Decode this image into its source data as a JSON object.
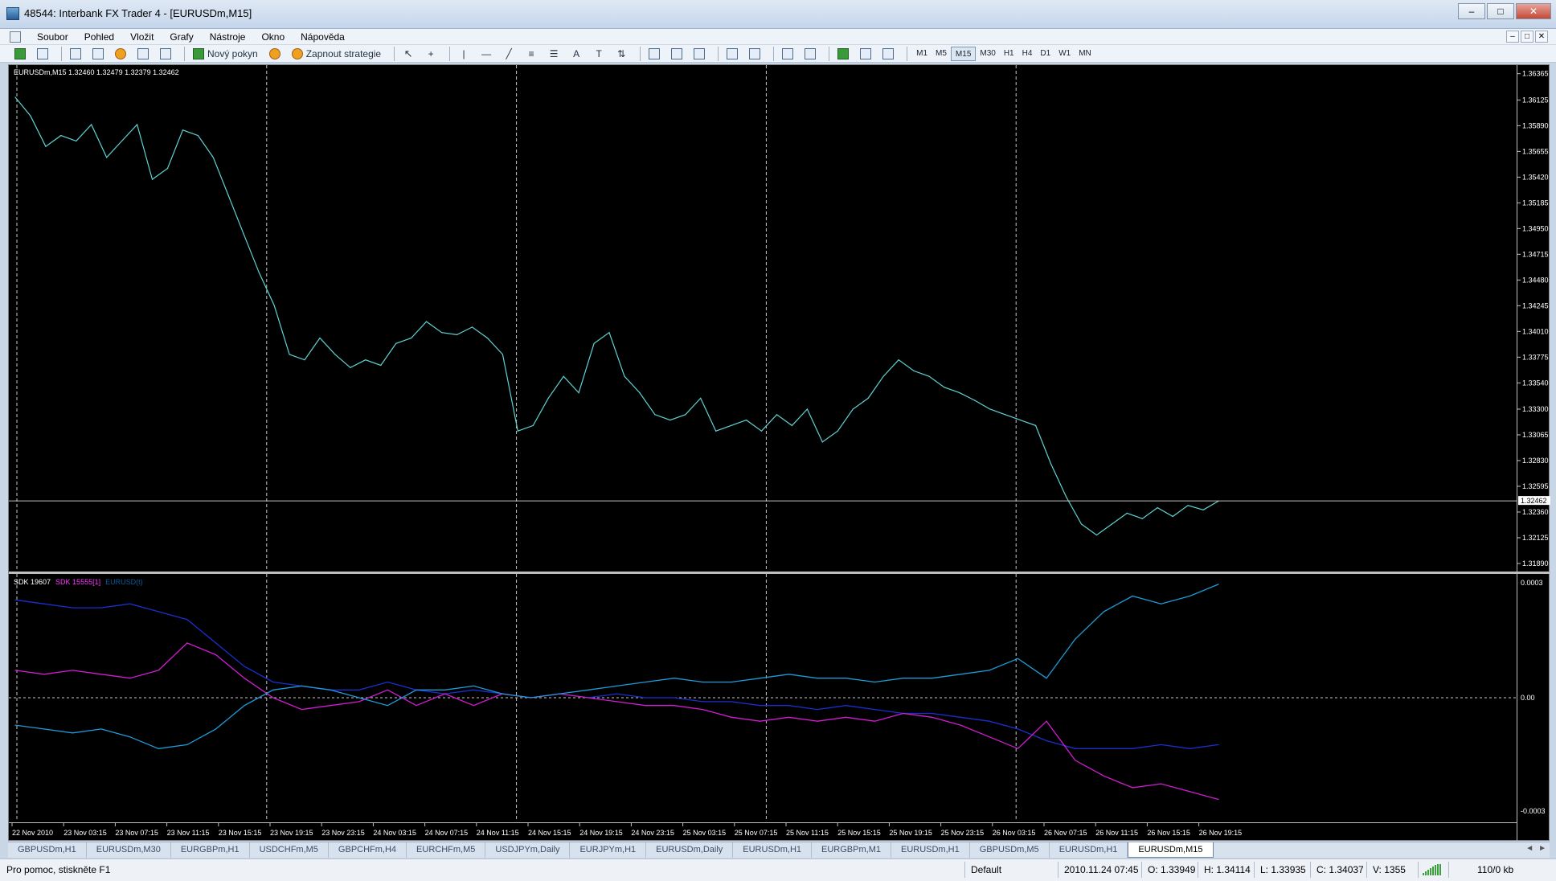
{
  "window": {
    "title": "48544: Interbank FX Trader 4 - [EURUSDm,M15]",
    "buttons": [
      "–",
      "□",
      "✕"
    ]
  },
  "menu": {
    "items": [
      "Soubor",
      "Pohled",
      "Vložit",
      "Grafy",
      "Nástroje",
      "Okno",
      "Nápověda"
    ],
    "mdi_buttons": [
      "–",
      "□",
      "✕"
    ]
  },
  "toolbar": {
    "new_order_label": "Nový pokyn",
    "strategies_label": "Zapnout strategie",
    "periods": [
      "M1",
      "M5",
      "M15",
      "M30",
      "H1",
      "H4",
      "D1",
      "W1",
      "MN"
    ],
    "active_period": "M15"
  },
  "chart": {
    "header": "EURUSDm,M15  1.32460 1.32479 1.32379 1.32462",
    "indicator_labels": [
      "SDK 19607",
      "SDK 15555[1]",
      "EURUSD(t)"
    ],
    "current_price_label": "1.32462",
    "accent_color": "#5fd3d3"
  },
  "chart_data": {
    "type": "line",
    "title": "EURUSDm,M15",
    "main_price": {
      "ylim": [
        1.3189,
        1.3637
      ],
      "yticks": [
        "1.36365",
        "1.36125",
        "1.35890",
        "1.35655",
        "1.35420",
        "1.35185",
        "1.34950",
        "1.34715",
        "1.34480",
        "1.34245",
        "1.34010",
        "1.33775",
        "1.33540",
        "1.33300",
        "1.33065",
        "1.32830",
        "1.32595",
        "1.32360",
        "1.32125",
        "1.31890"
      ],
      "last_price": 1.32462,
      "series": [
        {
          "values": [
            1.3615,
            1.3598,
            1.357,
            1.358,
            1.3575,
            1.359,
            1.356,
            1.3575,
            1.359,
            1.354,
            1.355,
            1.3585,
            1.358,
            1.356,
            1.3525,
            1.349,
            1.3455,
            1.3425,
            1.338,
            1.3375,
            1.3395,
            1.338,
            1.3368,
            1.3375,
            1.337,
            1.339,
            1.3395,
            1.341,
            1.34,
            1.3398,
            1.3405,
            1.3395,
            1.338,
            1.331,
            1.3315,
            1.334,
            1.336,
            1.3345,
            1.339,
            1.34,
            1.336,
            1.3345,
            1.3325,
            1.332,
            1.3325,
            1.334,
            1.331,
            1.3315,
            1.332,
            1.331,
            1.3325,
            1.3315,
            1.333,
            1.33,
            1.331,
            1.333,
            1.334,
            1.336,
            1.3375,
            1.3365,
            1.336,
            1.335,
            1.3345,
            1.3338,
            1.333,
            1.3325,
            1.332,
            1.3315,
            1.328,
            1.325,
            1.3225,
            1.3215,
            1.3225,
            1.3235,
            1.323,
            1.324,
            1.3232,
            1.3242,
            1.3238,
            1.3246
          ]
        }
      ]
    },
    "indicator": {
      "ylim": [
        -0.0003,
        0.0003
      ],
      "yticks": [
        "0.0003",
        "0.00",
        "-0.0003"
      ],
      "series": [
        {
          "values": [
            0.00025,
            0.00024,
            0.00023,
            0.00023,
            0.00024,
            0.00022,
            0.0002,
            0.00014,
            8e-05,
            4e-05,
            3e-05,
            2e-05,
            2e-05,
            4e-05,
            2e-05,
            1e-05,
            2e-05,
            1e-05,
            0.0,
            1e-05,
            0.0,
            1e-05,
            0.0,
            0.0,
            -1e-05,
            -1e-05,
            -2e-05,
            -2e-05,
            -3e-05,
            -2e-05,
            -3e-05,
            -4e-05,
            -4e-05,
            -5e-05,
            -6e-05,
            -8e-05,
            -0.00011,
            -0.00013,
            -0.00013,
            -0.00013,
            -0.00012,
            -0.00013,
            -0.00012
          ]
        },
        {
          "values": [
            7e-05,
            6e-05,
            7e-05,
            6e-05,
            5e-05,
            7e-05,
            0.00014,
            0.00011,
            5e-05,
            0.0,
            -3e-05,
            -2e-05,
            -1e-05,
            2e-05,
            -2e-05,
            1e-05,
            -2e-05,
            1e-05,
            0.0,
            1e-05,
            0.0,
            -1e-05,
            -2e-05,
            -2e-05,
            -3e-05,
            -5e-05,
            -6e-05,
            -5e-05,
            -6e-05,
            -5e-05,
            -6e-05,
            -4e-05,
            -5e-05,
            -7e-05,
            -0.0001,
            -0.00013,
            -6e-05,
            -0.00016,
            -0.0002,
            -0.00023,
            -0.00022,
            -0.00024,
            -0.00026
          ]
        },
        {
          "values": [
            -7e-05,
            -8e-05,
            -9e-05,
            -8e-05,
            -0.0001,
            -0.00013,
            -0.00012,
            -8e-05,
            -2e-05,
            2e-05,
            3e-05,
            2e-05,
            0.0,
            -2e-05,
            2e-05,
            2e-05,
            3e-05,
            1e-05,
            0.0,
            1e-05,
            2e-05,
            3e-05,
            4e-05,
            5e-05,
            4e-05,
            4e-05,
            5e-05,
            6e-05,
            5e-05,
            5e-05,
            4e-05,
            5e-05,
            5e-05,
            6e-05,
            7e-05,
            0.0001,
            5e-05,
            0.00015,
            0.00022,
            0.00026,
            0.00024,
            0.00026,
            0.00029
          ]
        }
      ]
    },
    "x_ticks": [
      "22 Nov 2010",
      "23 Nov 03:15",
      "23 Nov 07:15",
      "23 Nov 11:15",
      "23 Nov 15:15",
      "23 Nov 19:15",
      "23 Nov 23:15",
      "24 Nov 03:15",
      "24 Nov 07:15",
      "24 Nov 11:15",
      "24 Nov 15:15",
      "24 Nov 19:15",
      "24 Nov 23:15",
      "25 Nov 03:15",
      "25 Nov 07:15",
      "25 Nov 11:15",
      "25 Nov 15:15",
      "25 Nov 19:15",
      "25 Nov 23:15",
      "26 Nov 03:15",
      "26 Nov 07:15",
      "26 Nov 11:15",
      "26 Nov 15:15",
      "26 Nov 19:15"
    ],
    "grid": true,
    "series_colors": [
      "#5fd3d3",
      "#1b2fd0",
      "#d21bd2",
      "#1e9bd8"
    ]
  },
  "tabs": {
    "items": [
      "GBPUSDm,H1",
      "EURUSDm,M30",
      "EURGBPm,H1",
      "USDCHFm,M5",
      "GBPCHFm,H4",
      "EURCHFm,M5",
      "USDJPYm,Daily",
      "EURJPYm,H1",
      "EURUSDm,Daily",
      "EURUSDm,H1",
      "EURGBPm,M1",
      "EURUSDm,H1",
      "GBPUSDm,M5",
      "EURUSDm,H1",
      "EURUSDm,M15"
    ],
    "active_index": 14,
    "scroll": [
      "◄",
      "►"
    ]
  },
  "status": {
    "help": "Pro pomoc, stiskněte F1",
    "profile": "Default",
    "datetime": "2010.11.24 07:45",
    "open": "O: 1.33949",
    "high": "H: 1.34114",
    "low": "L: 1.33935",
    "close": "C: 1.34037",
    "volume": "V: 1355",
    "traffic": "110/0 kb"
  }
}
